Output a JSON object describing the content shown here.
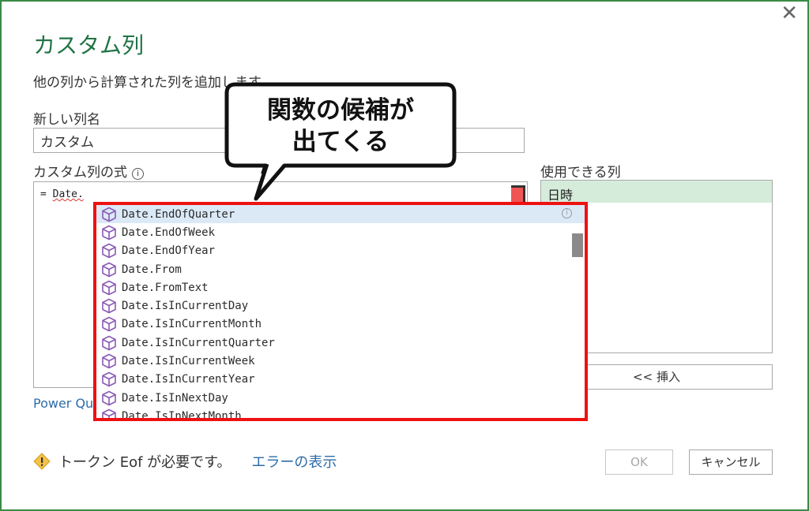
{
  "dialog": {
    "close_glyph": "✕",
    "title": "カスタム列",
    "subtitle": "他の列から計算された列を追加します。",
    "name_label": "新しい列名",
    "name_value": "カスタム",
    "formula_label": "カスタム列の式",
    "info_glyph": "i",
    "formula_prefix": "= ",
    "formula_token": "Date.",
    "columns_label": "使用できる列",
    "columns": [
      "日時"
    ],
    "insert_label": "<< 挿入",
    "pq_link": "Power Qu",
    "warning_text": "トークン Eof が必要です。",
    "error_link": "エラーの表示",
    "ok_label": "OK",
    "cancel_label": "キャンセル"
  },
  "suggestions": {
    "icon": "function-cube-icon",
    "items": [
      "Date.EndOfQuarter",
      "Date.EndOfWeek",
      "Date.EndOfYear",
      "Date.From",
      "Date.FromText",
      "Date.IsInCurrentDay",
      "Date.IsInCurrentMonth",
      "Date.IsInCurrentQuarter",
      "Date.IsInCurrentWeek",
      "Date.IsInCurrentYear",
      "Date.IsInNextDay",
      "Date.IsInNextMonth"
    ],
    "selected_index": 0
  },
  "callout": {
    "line1": "関数の候補が",
    "line2": "出てくる"
  },
  "colors": {
    "accent_green": "#217346",
    "highlight_red": "#ee1111",
    "link_blue": "#2d6ca8",
    "icon_purple": "#8a5ab5"
  }
}
